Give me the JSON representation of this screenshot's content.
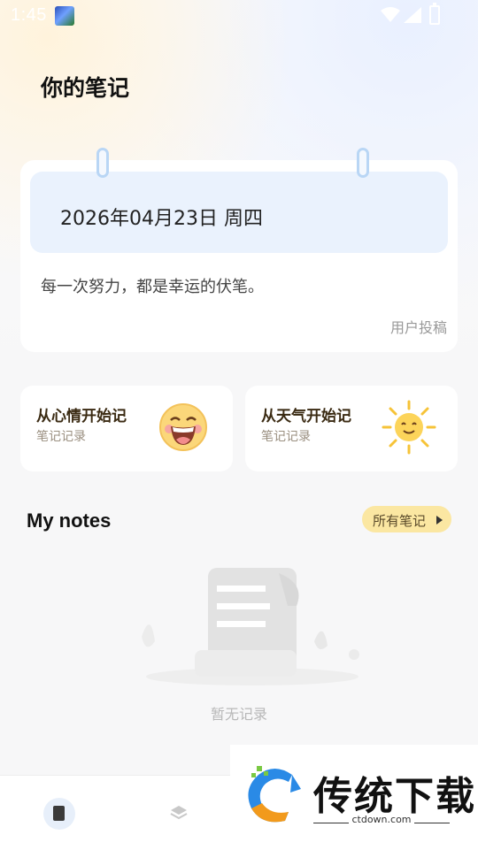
{
  "status_bar": {
    "time": "1:45"
  },
  "header": {
    "title": "你的笔记"
  },
  "date_card": {
    "date": "2026年04月23日 周四",
    "quote": "每一次努力，都是幸运的伏笔。",
    "source": "用户投稿"
  },
  "shortcuts": [
    {
      "title": "从心情开始记",
      "subtitle": "笔记记录",
      "icon": "laughing-face-icon"
    },
    {
      "title": "从天气开始记",
      "subtitle": "笔记记录",
      "icon": "sun-icon"
    }
  ],
  "notes": {
    "heading": "My notes",
    "all_button": "所有笔记",
    "empty_text": "暂无记录"
  },
  "bottom_nav": {
    "items": [
      "notebook-icon",
      "layers-icon"
    ]
  },
  "watermark": {
    "name": "传统下载",
    "url": "ctdown.com"
  },
  "colors": {
    "accent_yellow": "#fbe7a2",
    "date_panel": "#eaf2fd",
    "ring": "#b9d6f5"
  }
}
